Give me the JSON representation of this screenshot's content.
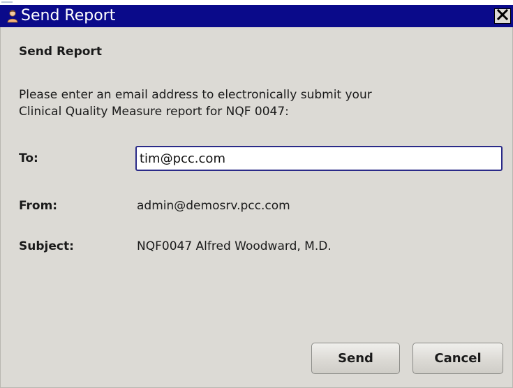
{
  "window": {
    "title": "Send Report",
    "title_bar_color": "#0a0a8a",
    "background_color": "#dcdad5",
    "app_icon": "user-icon",
    "close_icon": "close-icon"
  },
  "dialog": {
    "heading": "Send Report",
    "description_line1": "Please enter an email address to electronically submit your",
    "description_line2": "Clinical Quality Measure report for NQF 0047:"
  },
  "form": {
    "to_label": "To:",
    "to_value": "tim@pcc.com",
    "from_label": "From:",
    "from_value": "admin@demosrv.pcc.com",
    "subject_label": "Subject:",
    "subject_value": "NQF0047 Alfred Woodward, M.D."
  },
  "buttons": {
    "send_label": "Send",
    "cancel_label": "Cancel"
  }
}
